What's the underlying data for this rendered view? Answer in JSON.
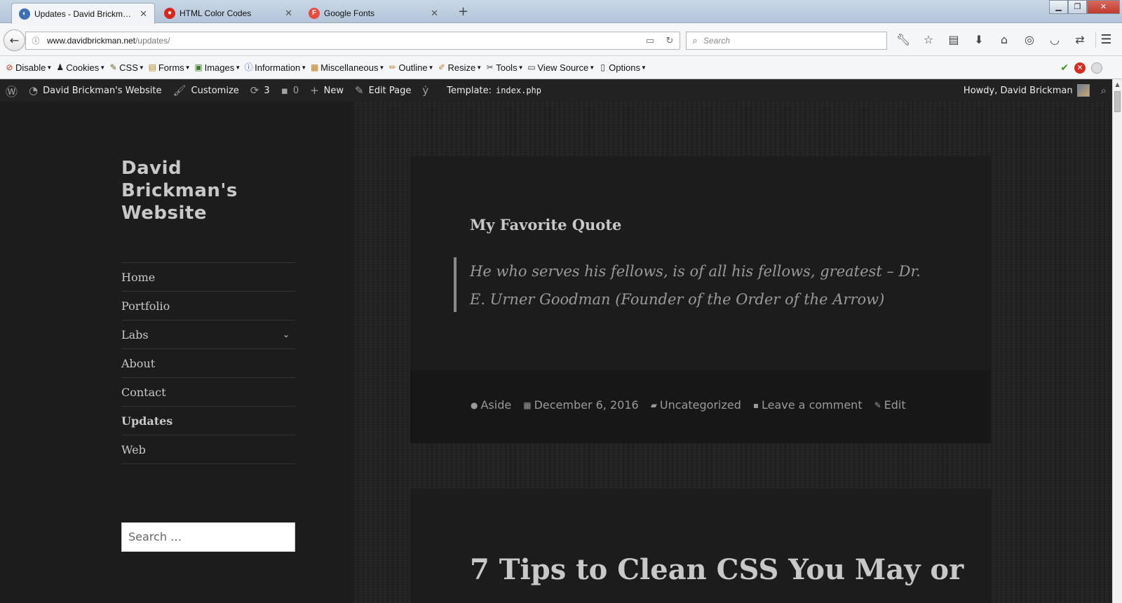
{
  "browser": {
    "tabs": [
      {
        "label": "Updates - David Brickman'...",
        "favicon_color": "#3b6fb6",
        "favicon_glyph": "◐",
        "active": true
      },
      {
        "label": "HTML Color Codes",
        "favicon_color": "#d6281c",
        "favicon_glyph": "●",
        "active": false
      },
      {
        "label": "Google Fonts",
        "favicon_color": "#e74c3c",
        "favicon_glyph": "F",
        "active": false
      }
    ],
    "new_tab_icon": "plus-icon",
    "url_domain": "www.davidbrickman.net",
    "url_path": "/updates/",
    "search_placeholder": "Search",
    "toolbar_icons": [
      "wrench-icon",
      "star-icon",
      "reader-icon",
      "download-icon",
      "home-icon",
      "globe-icon",
      "pocket-icon",
      "sync-icon"
    ]
  },
  "dev_toolbar": {
    "items": [
      {
        "label": "Disable",
        "icon": "disable-icon",
        "glyph": "⊘",
        "color": "#d62b1e"
      },
      {
        "label": "Cookies",
        "icon": "cookies-icon",
        "glyph": "♟",
        "color": "#222"
      },
      {
        "label": "CSS",
        "icon": "css-icon",
        "glyph": "✎",
        "color": "#6b5f1a"
      },
      {
        "label": "Forms",
        "icon": "forms-icon",
        "glyph": "▤",
        "color": "#b8862a"
      },
      {
        "label": "Images",
        "icon": "images-icon",
        "glyph": "▣",
        "color": "#3d7a2a"
      },
      {
        "label": "Information",
        "icon": "information-icon",
        "glyph": "ⓘ",
        "color": "#2a5fb8"
      },
      {
        "label": "Miscellaneous",
        "icon": "miscellaneous-icon",
        "glyph": "▦",
        "color": "#c47a14"
      },
      {
        "label": "Outline",
        "icon": "outline-icon",
        "glyph": "✏",
        "color": "#b8862a"
      },
      {
        "label": "Resize",
        "icon": "resize-icon",
        "glyph": "✐",
        "color": "#b8862a"
      },
      {
        "label": "Tools",
        "icon": "tools-icon",
        "glyph": "✂",
        "color": "#444"
      },
      {
        "label": "View Source",
        "icon": "view-source-icon",
        "glyph": "▭",
        "color": "#333"
      },
      {
        "label": "Options",
        "icon": "options-icon",
        "glyph": "▯",
        "color": "#333"
      }
    ]
  },
  "admin_bar": {
    "site_name": "David Brickman's Website",
    "customize": "Customize",
    "updates_count": "3",
    "comments_count": "0",
    "new_label": "New",
    "edit_page": "Edit Page",
    "template_label": "Template:",
    "template_file": "index.php",
    "howdy": "Howdy, David Brickman"
  },
  "sidebar": {
    "site_title": "David Brickman's Website",
    "nav": [
      {
        "label": "Home",
        "current": false,
        "has_children": false
      },
      {
        "label": "Portfolio",
        "current": false,
        "has_children": false
      },
      {
        "label": "Labs",
        "current": false,
        "has_children": true
      },
      {
        "label": "About",
        "current": false,
        "has_children": false
      },
      {
        "label": "Contact",
        "current": false,
        "has_children": false
      },
      {
        "label": "Updates",
        "current": true,
        "has_children": false
      },
      {
        "label": "Web",
        "current": false,
        "has_children": false
      }
    ],
    "search_placeholder": "Search …"
  },
  "posts": [
    {
      "title": "My Favorite Quote",
      "quote": "He who serves his fellows, is of all his fellows, greatest – Dr. E. Urner Goodman (Founder of the Order of the Arrow)",
      "meta": {
        "format": "Aside",
        "date": "December 6, 2016",
        "category": "Uncategorized",
        "comments": "Leave a comment",
        "edit": "Edit"
      }
    },
    {
      "title": "7 Tips to Clean CSS You May or"
    }
  ],
  "colors": {
    "page_bg": "#1c1c1c",
    "text": "#c8c8c8",
    "muted": "#9a9a9a",
    "admin_bar": "#222222"
  }
}
